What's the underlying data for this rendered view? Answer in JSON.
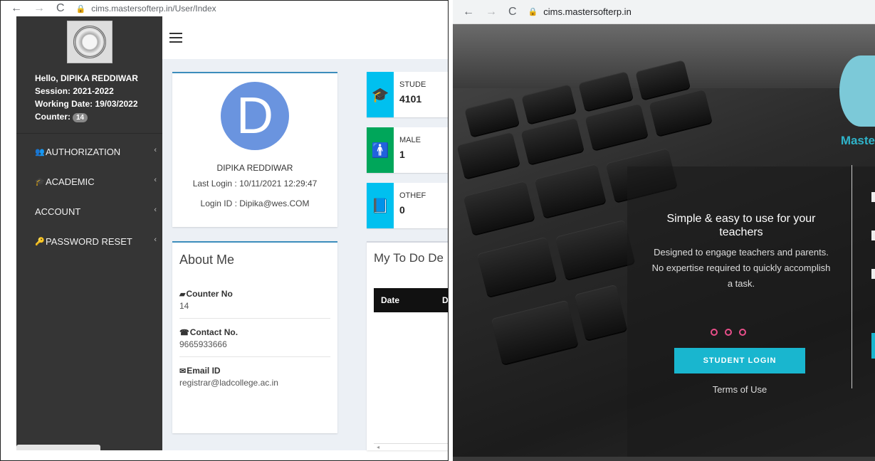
{
  "left": {
    "browser": {
      "back": "←",
      "forward": "→",
      "reload": "C",
      "lock": "🔒",
      "url": "cims.mastersofterp.in/User/Index"
    },
    "sidebar": {
      "greeting": "Hello, DIPIKA REDDIWAR",
      "session": "Session: 2021-2022",
      "working_date": "Working Date: 19/03/2022",
      "counter_label": "Counter:",
      "counter_value": "14",
      "items": [
        {
          "label": "AUTHORIZATION",
          "icon": "user-plus-icon",
          "glyph": "👥"
        },
        {
          "label": "ACADEMIC",
          "icon": "graduation-cap-icon",
          "glyph": "🎓"
        },
        {
          "label": "ACCOUNT",
          "icon": "",
          "glyph": ""
        },
        {
          "label": "PASSWORD RESET",
          "icon": "key-icon",
          "glyph": "🔑"
        }
      ],
      "chevron": "‹"
    },
    "profile": {
      "initial": "D",
      "avatar_color": "#6a94df",
      "name": "DIPIKA REDDIWAR",
      "last_login": "Last Login : 10/11/2021 12:29:47",
      "login_id": "Login ID : Dipika@wes.COM"
    },
    "stats": [
      {
        "label": "STUDE",
        "value": "4101",
        "color": "#00c0ef",
        "icon": "graduation-cap-icon",
        "glyph": "🎓"
      },
      {
        "label": "MALE",
        "value": "1",
        "color": "#00a65a",
        "icon": "male-icon",
        "glyph": "🚹"
      },
      {
        "label": "OTHEF",
        "value": "0",
        "color": "#00c0ef",
        "icon": "book-icon",
        "glyph": "📘"
      }
    ],
    "about": {
      "title": "About Me",
      "items": [
        {
          "label": "Counter No",
          "value": "14",
          "icon": "book-icon",
          "glyph": "▰"
        },
        {
          "label": "Contact No.",
          "value": "9665933666",
          "icon": "phone-icon",
          "glyph": "☎"
        },
        {
          "label": "Email ID",
          "value": "registrar@ladcollege.ac.in",
          "icon": "envelope-icon",
          "glyph": "✉"
        }
      ]
    },
    "todo": {
      "title": "My To Do De",
      "col_date": "Date",
      "col_2": "D",
      "scroll_arrow": "◂"
    }
  },
  "right": {
    "browser": {
      "back": "←",
      "forward": "→",
      "reload": "C",
      "lock": "🔒",
      "url": "cims.mastersofterp.in"
    },
    "brand": "Maste",
    "brand_color": "#2fb3c9",
    "slide": {
      "title": "Simple & easy to use for your teachers",
      "description": "Designed to engage teachers and parents. No expertise required to quickly accomplish a task."
    },
    "login_button": "STUDENT LOGIN",
    "terms": "Terms of Use",
    "accent": "#19b6cf",
    "dot_color": "#e84f8a"
  }
}
